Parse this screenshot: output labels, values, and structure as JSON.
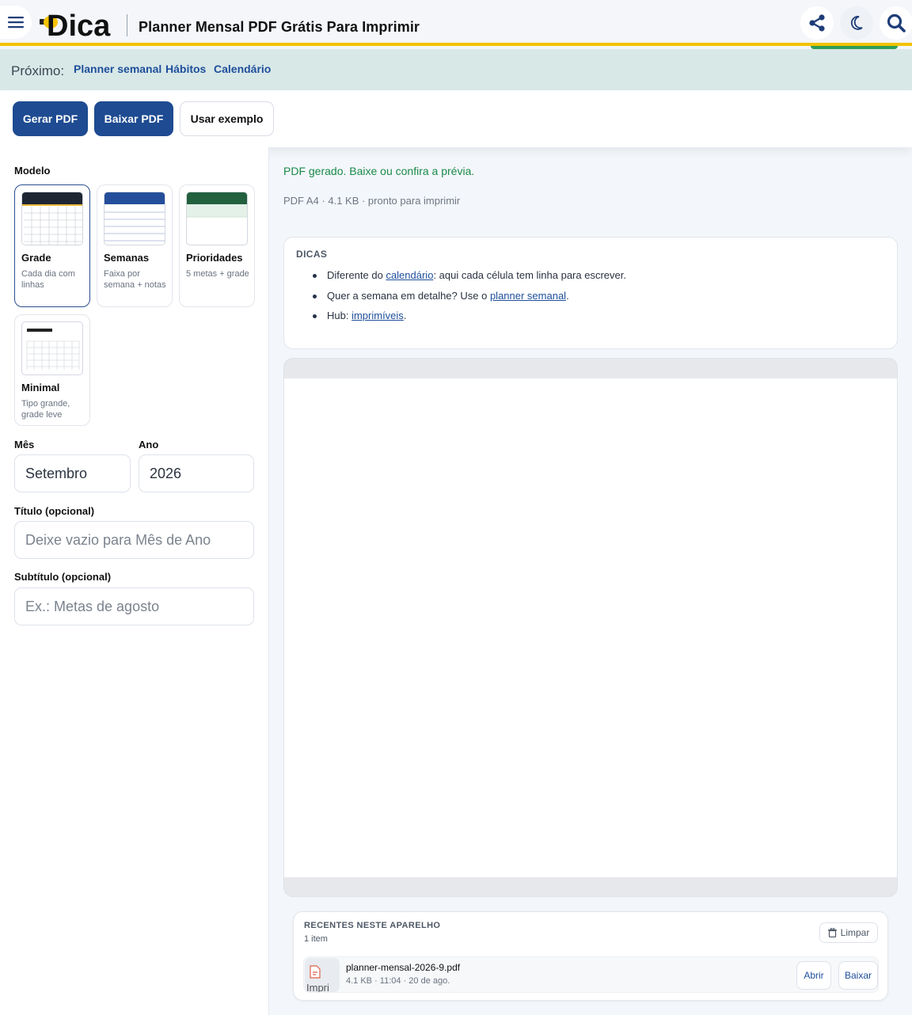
{
  "header": {
    "logo_text": "Dica",
    "title": "Planner Mensal PDF Grátis Para Imprimir",
    "menu_icon": "hamburger-icon",
    "share_icon": "share-icon",
    "theme_icon": "moon-icon",
    "search_icon": "search-icon"
  },
  "next_bar": {
    "label": "Próximo:",
    "links": [
      "Planner semanal",
      "Hábitos",
      "Calendário"
    ]
  },
  "toolbar": {
    "generate_label": "Gerar PDF",
    "download_label": "Baixar PDF",
    "example_label": "Usar exemplo"
  },
  "form": {
    "model_label": "Modelo",
    "templates": [
      {
        "name": "Grade",
        "desc": "Cada dia com linhas",
        "selected": true
      },
      {
        "name": "Semanas",
        "desc": "Faixa por semana + notas",
        "selected": false
      },
      {
        "name": "Prioridades",
        "desc": "5 metas + grade",
        "selected": false
      },
      {
        "name": "Minimal",
        "desc": "Tipo grande, grade leve",
        "selected": false
      }
    ],
    "month_label": "Mês",
    "month_value": "Setembro",
    "year_label": "Ano",
    "year_value": "2026",
    "title_label": "Título (opcional)",
    "title_placeholder": "Deixe vazio para Mês de Ano",
    "subtitle_label": "Subtítulo (opcional)",
    "subtitle_placeholder": "Ex.: Metas de agosto"
  },
  "status": {
    "message": "PDF gerado. Baixe ou confira a prévia.",
    "meta": "PDF A4 · 4.1 KB · pronto para imprimir"
  },
  "tips": {
    "title": "DICAS",
    "items": [
      {
        "pre": "Diferente do ",
        "link": "calendário",
        "post": ": aqui cada célula tem linha para escrever."
      },
      {
        "pre": "Quer a semana em detalhe? Use o ",
        "link": "planner semanal",
        "post": "."
      },
      {
        "pre": "Hub: ",
        "link": "imprimíveis",
        "post": "."
      }
    ]
  },
  "recents": {
    "title": "RECENTES NESTE APARELHO",
    "count": "1 item",
    "clear_label": "Limpar",
    "items": [
      {
        "name": "planner-mensal-2026-9.pdf",
        "meta": "4.1 KB · 11:04 · 20 de ago.",
        "thumb_text": "Impri",
        "open_label": "Abrir",
        "download_label": "Baixar"
      }
    ]
  },
  "colors": {
    "accent": "#1e4b91",
    "header_border": "#f2c200",
    "next_bar_bg": "#d8e8e7",
    "success": "#1b8a4a",
    "grade_header": "#1f2633",
    "semanas_header": "#254e9a",
    "prioridades_header": "#22603e"
  }
}
